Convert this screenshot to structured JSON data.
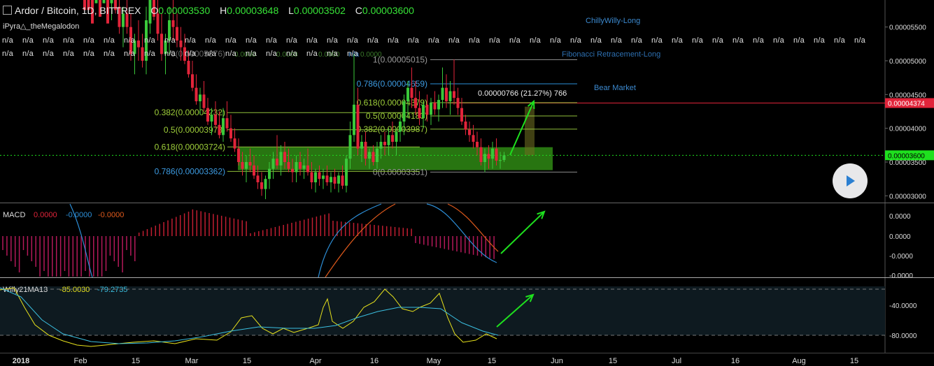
{
  "header": {
    "symbol": "Ardor / Bitcoin, 1D, BITTREX",
    "o_label": "O",
    "o": "0.00003530",
    "h_label": "H",
    "h": "0.00003648",
    "l_label": "L",
    "l": "0.00003502",
    "c_label": "C",
    "c": "0.00003600",
    "indicator": "iPyra△_theMegalodon",
    "na_text": "n/a"
  },
  "colors": {
    "up": "#3ac83a",
    "down": "#e2243a",
    "grid": "#2a2a2a",
    "fib": "#8a8a8a",
    "zone": "#2f8a14",
    "accent_green": "#1ee01e",
    "blue": "#2d8fd8",
    "orange": "#e05a1c",
    "yellow": "#e7e21c"
  },
  "chart_data": [
    {
      "type": "candlestick",
      "title": "Ardor / Bitcoin, 1D, BITTREX",
      "ylim": [
        2.9e-05,
        5.9e-05
      ],
      "y_ticks": [
        "0.00005500",
        "0.00005000",
        "0.00004500",
        "0.00004000",
        "0.00003500",
        "0.00003000"
      ],
      "y_tick_values": [
        5.5e-05,
        5e-05,
        4.5e-05,
        4e-05,
        3.5e-05,
        3e-05
      ],
      "price_badges": [
        {
          "label": "0.00004374",
          "value": 4.374e-05,
          "color": "#e2243a"
        },
        {
          "label": "0.00003600",
          "value": 3.6e-05,
          "color": "#1ee01e"
        }
      ],
      "x_ticks": [
        "2018",
        "Feb",
        "15",
        "Mar",
        "15",
        "Apr",
        "16",
        "May",
        "15",
        "Jun",
        "15",
        "Jul",
        "16",
        "Aug",
        "15"
      ],
      "candles": [
        [
          7.2e-05,
          7.7e-05,
          6.6e-05,
          7e-05
        ],
        [
          7e-05,
          7.4e-05,
          6.5e-05,
          6.8e-05
        ],
        [
          6.8e-05,
          7.1e-05,
          6.2e-05,
          6.4e-05
        ],
        [
          6.4e-05,
          6.7e-05,
          6e-05,
          6.5e-05
        ],
        [
          6.5e-05,
          6.9e-05,
          6.1e-05,
          6.2e-05
        ],
        [
          6.2e-05,
          6.5e-05,
          5.9e-05,
          6.3e-05
        ],
        [
          6.3e-05,
          6.6e-05,
          5.8e-05,
          5.9e-05
        ],
        [
          5.9e-05,
          6.2e-05,
          5.6e-05,
          6e-05
        ],
        [
          6e-05,
          6.4e-05,
          5.7e-05,
          5.8e-05
        ],
        [
          5.8e-05,
          6e-05,
          5.4e-05,
          5.5e-05
        ],
        [
          5.5e-05,
          5.8e-05,
          5.2e-05,
          5.7e-05
        ],
        [
          5.7e-05,
          6e-05,
          5.4e-05,
          5.5e-05
        ],
        [
          5.5e-05,
          5.7e-05,
          5e-05,
          5.1e-05
        ],
        [
          5.1e-05,
          5.4e-05,
          4.8e-05,
          5.3e-05
        ],
        [
          5.3e-05,
          5.6e-05,
          5e-05,
          5.2e-05
        ],
        [
          5.2e-05,
          5.4e-05,
          4.9e-05,
          5e-05
        ],
        [
          5e-05,
          5.8e-05,
          4.8e-05,
          5.6e-05
        ],
        [
          5.6e-05,
          6.2e-05,
          5.4e-05,
          6e-05
        ],
        [
          6e-05,
          6.4e-05,
          5.6e-05,
          5.7e-05
        ],
        [
          5.7e-05,
          6e-05,
          5.3e-05,
          5.4e-05
        ],
        [
          5.4e-05,
          5.7e-05,
          5e-05,
          5.1e-05
        ],
        [
          5.1e-05,
          5.4e-05,
          4.8e-05,
          5.3e-05
        ],
        [
          5.3e-05,
          5.8e-05,
          5.1e-05,
          5.6e-05
        ],
        [
          5.6e-05,
          6e-05,
          5.3e-05,
          5.5e-05
        ],
        [
          5.5e-05,
          5.7e-05,
          5.2e-05,
          5.3e-05
        ],
        [
          5.3e-05,
          5.5e-05,
          5e-05,
          5.2e-05
        ],
        [
          5.2e-05,
          5.4e-05,
          4.95e-05,
          5e-05
        ],
        [
          5e-05,
          5.15e-05,
          4.75e-05,
          4.8e-05
        ],
        [
          4.8e-05,
          5e-05,
          4.55e-05,
          4.6e-05
        ],
        [
          4.6e-05,
          4.8e-05,
          4.35e-05,
          4.4e-05
        ],
        [
          4.4e-05,
          4.6e-05,
          4.2e-05,
          4.5e-05
        ],
        [
          4.5e-05,
          4.7e-05,
          4.25e-05,
          4.3e-05
        ],
        [
          4.3e-05,
          4.45e-05,
          4.05e-05,
          4.1e-05
        ],
        [
          4.1e-05,
          4.3e-05,
          3.9e-05,
          4.2e-05
        ],
        [
          4.2e-05,
          4.4e-05,
          4e-05,
          4.05e-05
        ],
        [
          4.05e-05,
          4.25e-05,
          3.85e-05,
          3.9e-05
        ],
        [
          3.9e-05,
          4.3e-05,
          3.8e-05,
          4.15e-05
        ],
        [
          4.15e-05,
          4.4e-05,
          3.95e-05,
          4e-05
        ],
        [
          4e-05,
          4.2e-05,
          3.8e-05,
          3.85e-05
        ],
        [
          3.85e-05,
          4e-05,
          3.65e-05,
          3.7e-05
        ],
        [
          3.7e-05,
          3.85e-05,
          3.45e-05,
          3.5e-05
        ],
        [
          3.5e-05,
          3.65e-05,
          3.3e-05,
          3.4e-05
        ],
        [
          3.4e-05,
          3.6e-05,
          3.2e-05,
          3.5e-05
        ],
        [
          3.5e-05,
          3.7e-05,
          3.35e-05,
          3.45e-05
        ],
        [
          3.45e-05,
          3.6e-05,
          3.25e-05,
          3.3e-05
        ],
        [
          3.3e-05,
          3.45e-05,
          3.1e-05,
          3.2e-05
        ],
        [
          3.2e-05,
          3.35e-05,
          3e-05,
          3.1e-05
        ],
        [
          3.1e-05,
          3.3e-05,
          2.95e-05,
          3.25e-05
        ],
        [
          3.25e-05,
          3.5e-05,
          3.1e-05,
          3.4e-05
        ],
        [
          3.4e-05,
          3.65e-05,
          3.25e-05,
          3.55e-05
        ],
        [
          3.55e-05,
          3.9e-05,
          3.4e-05,
          3.45e-05
        ],
        [
          3.45e-05,
          3.75e-05,
          3.3e-05,
          3.65e-05
        ],
        [
          3.65e-05,
          3.8e-05,
          3.4e-05,
          3.5e-05
        ],
        [
          3.5e-05,
          3.7e-05,
          3.35e-05,
          3.4e-05
        ],
        [
          3.4e-05,
          3.55e-05,
          3.2e-05,
          3.35e-05
        ],
        [
          3.35e-05,
          3.6e-05,
          3.2e-05,
          3.5e-05
        ],
        [
          3.5e-05,
          3.65e-05,
          3.3e-05,
          3.4e-05
        ],
        [
          3.4e-05,
          3.55e-05,
          3.25e-05,
          3.45e-05
        ],
        [
          3.45e-05,
          3.7e-05,
          3.3e-05,
          3.35e-05
        ],
        [
          3.35e-05,
          3.5e-05,
          3.1e-05,
          3.2e-05
        ],
        [
          3.2e-05,
          3.4e-05,
          3.05e-05,
          3.35e-05
        ],
        [
          3.35e-05,
          3.45e-05,
          3.15e-05,
          3.25e-05
        ],
        [
          3.25e-05,
          3.4e-05,
          3.1e-05,
          3.3e-05
        ],
        [
          3.3e-05,
          3.45e-05,
          3.15e-05,
          3.2e-05
        ],
        [
          3.2e-05,
          3.35e-05,
          3.05e-05,
          3.28e-05
        ],
        [
          3.28e-05,
          3.4e-05,
          3.1e-05,
          3.18e-05
        ],
        [
          3.18e-05,
          3.35e-05,
          3.05e-05,
          3.3e-05
        ],
        [
          3.3e-05,
          3.45e-05,
          3.1e-05,
          3.15e-05
        ],
        [
          3.15e-05,
          3.6e-05,
          3.05e-05,
          3.55e-05
        ],
        [
          3.55e-05,
          4.1e-05,
          3.4e-05,
          3.9e-05
        ],
        [
          3.9e-05,
          5.1e-05,
          3.8e-05,
          4.35e-05
        ],
        [
          4.35e-05,
          4.6e-05,
          3.6e-05,
          3.7e-05
        ],
        [
          3.7e-05,
          3.9e-05,
          3.5e-05,
          3.8e-05
        ],
        [
          3.8e-05,
          3.95e-05,
          3.45e-05,
          3.55e-05
        ],
        [
          3.55e-05,
          3.7e-05,
          3.4e-05,
          3.65e-05
        ],
        [
          3.65e-05,
          3.75e-05,
          3.45e-05,
          3.5e-05
        ],
        [
          3.5e-05,
          3.8e-05,
          3.4e-05,
          3.7e-05
        ],
        [
          3.7e-05,
          3.9e-05,
          3.55e-05,
          3.8e-05
        ],
        [
          3.8e-05,
          3.95e-05,
          3.6e-05,
          3.75e-05
        ],
        [
          3.75e-05,
          4e-05,
          3.6e-05,
          3.9e-05
        ],
        [
          3.9e-05,
          4.1e-05,
          3.7e-05,
          3.8e-05
        ],
        [
          3.8e-05,
          4e-05,
          3.6e-05,
          3.95e-05
        ],
        [
          3.95e-05,
          4.2e-05,
          3.8e-05,
          4.1e-05
        ],
        [
          4.1e-05,
          4.5e-05,
          3.9e-05,
          4.4e-05
        ],
        [
          4.4e-05,
          4.7e-05,
          4.15e-05,
          4.6e-05
        ],
        [
          4.6e-05,
          4.9e-05,
          4.3e-05,
          4.45e-05
        ],
        [
          4.45e-05,
          4.7e-05,
          4.2e-05,
          4.3e-05
        ],
        [
          4.3e-05,
          4.55e-05,
          4.05e-05,
          4.15e-05
        ],
        [
          4.15e-05,
          4.4e-05,
          4e-05,
          4.35e-05
        ],
        [
          4.35e-05,
          4.5e-05,
          4.1e-05,
          4.2e-05
        ],
        [
          4.2e-05,
          4.45e-05,
          4.05e-05,
          4.38e-05
        ],
        [
          4.38e-05,
          4.55e-05,
          4.2e-05,
          4.28e-05
        ],
        [
          4.28e-05,
          4.5e-05,
          4.1e-05,
          4.42e-05
        ],
        [
          4.42e-05,
          4.9e-05,
          4.3e-05,
          4.6e-05
        ],
        [
          4.6e-05,
          4.8e-05,
          4.3e-05,
          4.4e-05
        ],
        [
          4.4e-05,
          4.7e-05,
          4.2e-05,
          4.55e-05
        ],
        [
          4.55e-05,
          5.02e-05,
          4.35e-05,
          4.45e-05
        ],
        [
          4.45e-05,
          4.6e-05,
          4.2e-05,
          4.3e-05
        ],
        [
          4.3e-05,
          4.45e-05,
          4.05e-05,
          4.1e-05
        ],
        [
          4.1e-05,
          4.2e-05,
          3.9e-05,
          3.98e-05
        ],
        [
          3.98e-05,
          4.1e-05,
          3.8e-05,
          3.9e-05
        ],
        [
          3.9e-05,
          4.05e-05,
          3.7e-05,
          3.8e-05
        ],
        [
          3.8e-05,
          3.95e-05,
          3.6e-05,
          3.72e-05
        ],
        [
          3.72e-05,
          3.85e-05,
          3.45e-05,
          3.5e-05
        ],
        [
          3.5e-05,
          3.7e-05,
          3.35e-05,
          3.62e-05
        ],
        [
          3.62e-05,
          3.75e-05,
          3.4e-05,
          3.55e-05
        ],
        [
          3.55e-05,
          3.8e-05,
          3.4e-05,
          3.7e-05
        ],
        [
          3.7e-05,
          3.85e-05,
          3.45e-05,
          3.52e-05
        ],
        [
          3.52e-05,
          3.65e-05,
          3.4e-05,
          3.53e-05
        ],
        [
          3.53e-05,
          3.65e-05,
          3.5e-05,
          3.6e-05
        ]
      ],
      "fib_retracement": {
        "name": "Fibonacci Retracement-Long",
        "levels": [
          {
            "label": "1(0.00005015)",
            "value": 5.015e-05
          },
          {
            "label": "0.786(0.00004659)",
            "value": 4.659e-05
          },
          {
            "label": "0.618(0.00004379)",
            "value": 4.379e-05
          },
          {
            "label": "0.5(0.00004183)",
            "value": 4.183e-05
          },
          {
            "label": "0.382(0.00003987)",
            "value": 3.987e-05
          },
          {
            "label": "0(0.00003351)",
            "value": 3.351e-05
          }
        ]
      },
      "fib_left_labels": [
        {
          "label": "0(0.00005876)",
          "value": 5.015e-05
        },
        {
          "label": "0.382(0.00004232)",
          "value": 4.232e-05
        },
        {
          "label": "0.5(0.00003978)",
          "value": 3.978e-05
        },
        {
          "label": "0.618(0.00003724)",
          "value": 3.724e-05
        },
        {
          "label": "0.786(0.00003362)",
          "value": 3.362e-05
        }
      ],
      "small_labels": [
        "0.0000",
        "0.0000",
        "0.0000",
        "0.0000"
      ],
      "zone_ylim": [
        3.38e-05,
        3.72e-05
      ],
      "target_label": "0.00000766 (21.27%) 766",
      "annotations": [
        "ChillyWilly-Long",
        "Bear Market"
      ]
    },
    {
      "type": "line",
      "title": "MACD",
      "legend_values": [
        "0.0000",
        "-0.0000",
        "-0.0000"
      ],
      "y_ticks": [
        "0.0000",
        "0.0000",
        "-0.0000",
        "-0.0000"
      ]
    },
    {
      "type": "line",
      "title": "Willy21MA13",
      "legend_values": [
        "-85.0030",
        "-79.2735"
      ],
      "y_ticks": [
        "-40.0000",
        "-80.0000"
      ]
    }
  ]
}
